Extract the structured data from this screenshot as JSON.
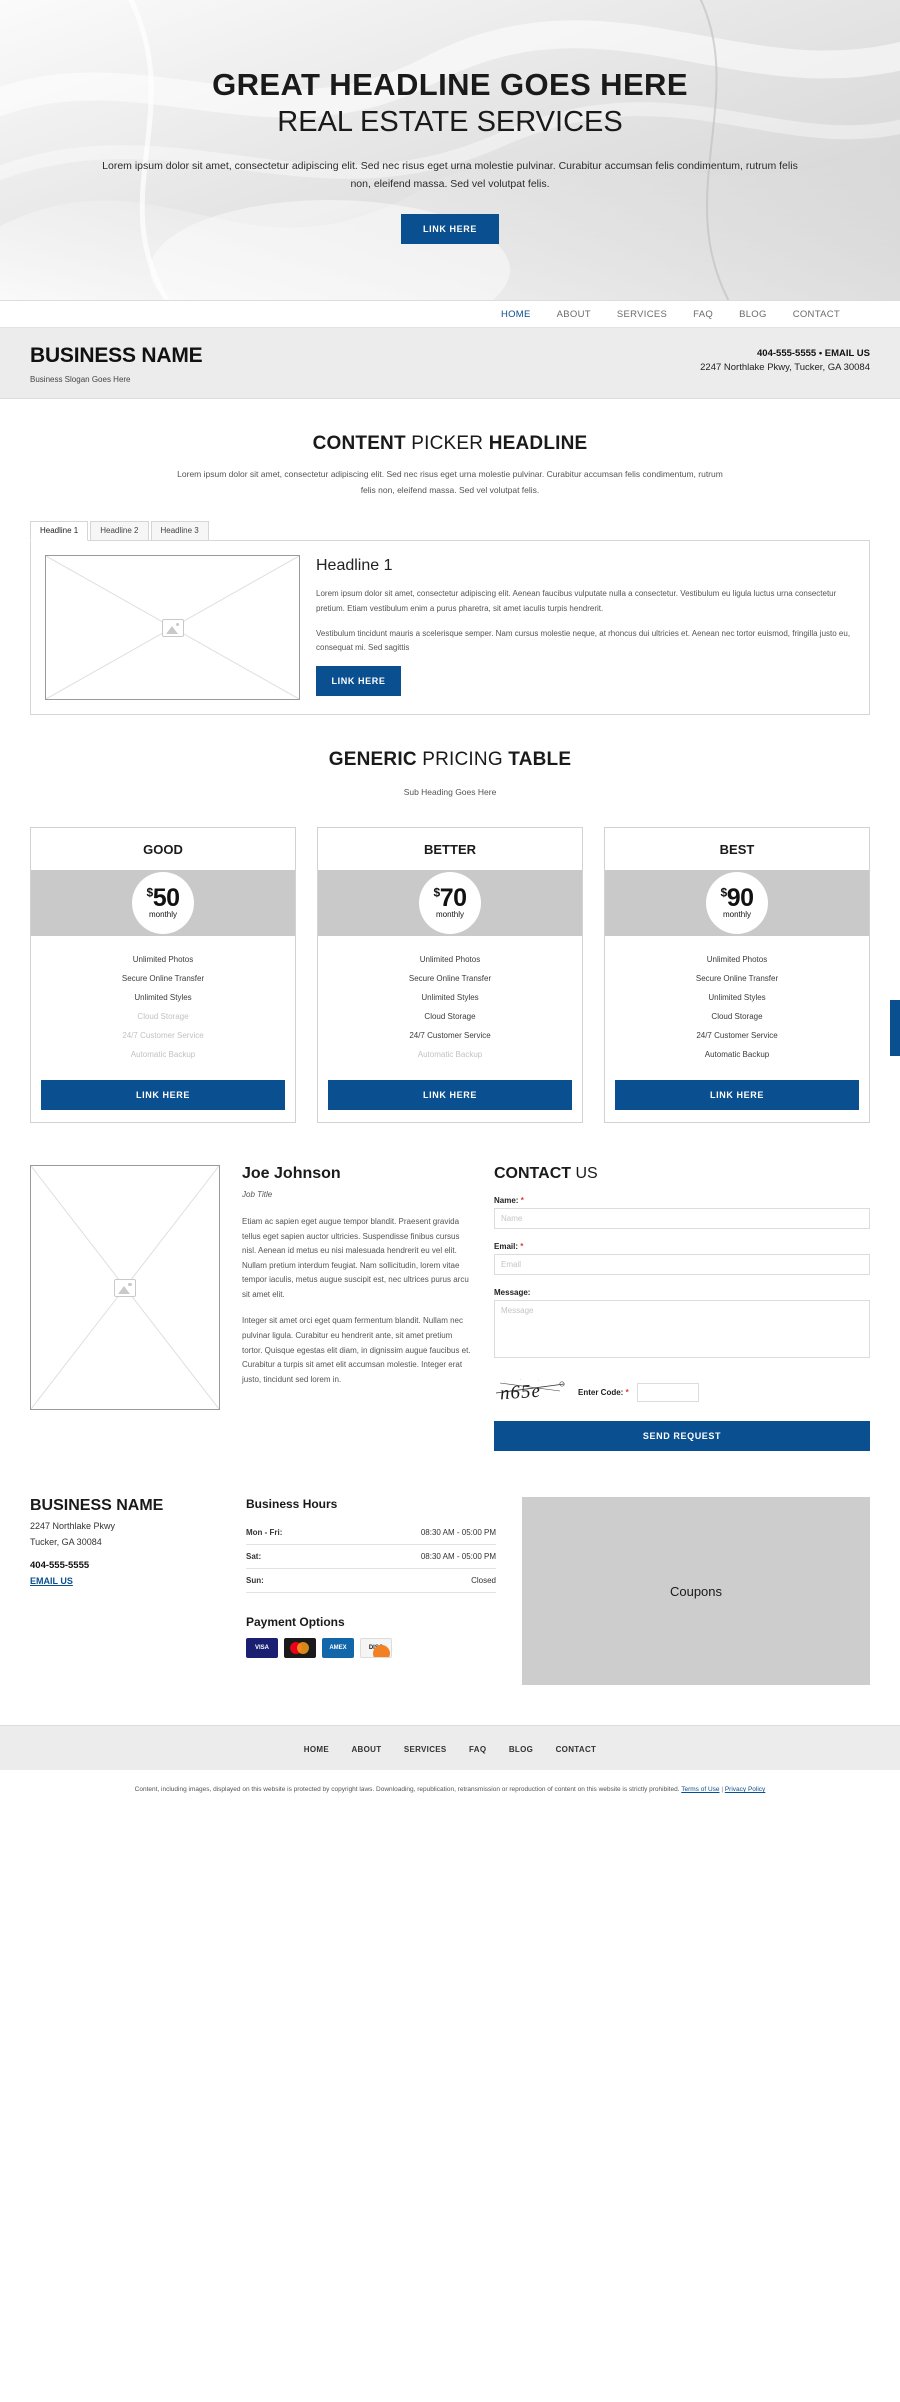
{
  "hero": {
    "headline": "GREAT HEADLINE GOES HERE",
    "subheadline": "REAL ESTATE SERVICES",
    "paragraph": "Lorem ipsum dolor sit amet, consectetur adipiscing elit. Sed nec risus eget urna molestie pulvinar. Curabitur accumsan felis condimentum, rutrum felis non, eleifend massa. Sed vel volutpat felis.",
    "button_label": "LINK HERE"
  },
  "nav": {
    "items": [
      {
        "label": "HOME",
        "active": true
      },
      {
        "label": "ABOUT",
        "active": false
      },
      {
        "label": "SERVICES",
        "active": false
      },
      {
        "label": "FAQ",
        "active": false
      },
      {
        "label": "BLOG",
        "active": false
      },
      {
        "label": "CONTACT",
        "active": false
      }
    ]
  },
  "business_header": {
    "name": "BUSINESS NAME",
    "slogan": "Business Slogan Goes Here",
    "phone_email": "404-555-5555 • EMAIL US",
    "address": "2247 Northlake Pkwy, Tucker, GA 30084"
  },
  "content_picker": {
    "title_part1": "CONTENT",
    "title_part2": "PICKER",
    "title_part3": "HEADLINE",
    "subtitle": "Lorem ipsum dolor sit amet, consectetur adipiscing elit. Sed nec risus eget urna molestie pulvinar. Curabitur accumsan felis condimentum, rutrum felis non, eleifend massa. Sed vel volutpat felis.",
    "tabs": [
      {
        "label": "Headline 1",
        "active": true
      },
      {
        "label": "Headline 2",
        "active": false
      },
      {
        "label": "Headline 3",
        "active": false
      }
    ],
    "panel": {
      "heading": "Headline 1",
      "paragraph1": "Lorem ipsum dolor sit amet, consectetur adipiscing elit. Aenean faucibus vulputate nulla a consectetur. Vestibulum eu ligula luctus urna consectetur pretium. Etiam vestibulum enim a purus pharetra, sit amet iaculis turpis hendrerit.",
      "paragraph2": "Vestibulum tincidunt mauris a scelerisque semper. Nam cursus molestie neque, at rhoncus dui ultricies et. Aenean nec tortor euismod, fringilla justo eu, consequat mi. Sed sagittis",
      "button_label": "LINK HERE"
    }
  },
  "pricing": {
    "title_part1": "GENERIC",
    "title_part2": "PRICING",
    "title_part3": "TABLE",
    "subheading": "Sub Heading Goes Here",
    "plans": [
      {
        "name": "GOOD",
        "currency": "$",
        "amount": "50",
        "period": "monthly",
        "button_label": "LINK HERE",
        "features": [
          {
            "label": "Unlimited Photos",
            "enabled": true
          },
          {
            "label": "Secure Online Transfer",
            "enabled": true
          },
          {
            "label": "Unlimited Styles",
            "enabled": true
          },
          {
            "label": "Cloud Storage",
            "enabled": false
          },
          {
            "label": "24/7 Customer Service",
            "enabled": false
          },
          {
            "label": "Automatic Backup",
            "enabled": false
          }
        ]
      },
      {
        "name": "BETTER",
        "currency": "$",
        "amount": "70",
        "period": "monthly",
        "button_label": "LINK HERE",
        "features": [
          {
            "label": "Unlimited Photos",
            "enabled": true
          },
          {
            "label": "Secure Online Transfer",
            "enabled": true
          },
          {
            "label": "Unlimited Styles",
            "enabled": true
          },
          {
            "label": "Cloud Storage",
            "enabled": true
          },
          {
            "label": "24/7 Customer Service",
            "enabled": true
          },
          {
            "label": "Automatic Backup",
            "enabled": false
          }
        ]
      },
      {
        "name": "BEST",
        "currency": "$",
        "amount": "90",
        "period": "monthly",
        "button_label": "LINK HERE",
        "features": [
          {
            "label": "Unlimited Photos",
            "enabled": true
          },
          {
            "label": "Secure Online Transfer",
            "enabled": true
          },
          {
            "label": "Unlimited Styles",
            "enabled": true
          },
          {
            "label": "Cloud Storage",
            "enabled": true
          },
          {
            "label": "24/7 Customer Service",
            "enabled": true
          },
          {
            "label": "Automatic Backup",
            "enabled": true
          }
        ]
      }
    ]
  },
  "bio": {
    "name": "Joe Johnson",
    "job_title": "Job Title",
    "paragraph1": "Etiam ac sapien eget augue tempor blandit. Praesent gravida tellus eget sapien auctor ultricies. Suspendisse finibus cursus nisl. Aenean id metus eu nisi malesuada hendrerit eu vel elit. Nullam pretium interdum feugiat. Nam sollicitudin, lorem vitae tempor iaculis, metus augue suscipit est, nec ultrices purus arcu sit amet elit.",
    "paragraph2": "Integer sit amet orci eget quam fermentum blandit. Nullam nec pulvinar ligula. Curabitur eu hendrerit ante, sit amet pretium tortor. Quisque egestas elit diam, in dignissim augue faucibus et. Curabitur a turpis sit amet elit accumsan molestie. Integer erat justo, tincidunt sed lorem in."
  },
  "contact": {
    "title_part1": "CONTACT",
    "title_part2": "US",
    "name_label": "Name:",
    "name_placeholder": "Name",
    "name_value": "",
    "email_label": "Email:",
    "email_placeholder": "Email",
    "email_value": "",
    "message_label": "Message:",
    "message_placeholder": "Message",
    "message_value": "",
    "captcha_code": "n65e",
    "enter_code_label": "Enter Code:",
    "code_value": "",
    "required_marker": "*",
    "submit_label": "SEND REQUEST"
  },
  "footer": {
    "business_name": "BUSINESS NAME",
    "address_line1": "2247 Northlake Pkwy",
    "address_line2": "Tucker, GA 30084",
    "phone": "404-555-5555",
    "email_label": "EMAIL US",
    "hours_title": "Business Hours",
    "hours": [
      {
        "day": "Mon - Fri:",
        "time": "08:30 AM - 05:00 PM"
      },
      {
        "day": "Sat:",
        "time": "08:30 AM - 05:00 PM"
      },
      {
        "day": "Sun:",
        "time": "Closed"
      }
    ],
    "payment_title": "Payment Options",
    "payment_cards": [
      "VISA",
      "MasterCard",
      "AMEX",
      "DISCOVER"
    ],
    "coupons_label": "Coupons",
    "nav_items": [
      "HOME",
      "ABOUT",
      "SERVICES",
      "FAQ",
      "BLOG",
      "CONTACT"
    ],
    "legal_text": "Content, including images, displayed on this website is protected by copyright laws. Downloading, republication, retransmission or reproduction of content on this website is strictly prohibited.",
    "legal_link1": "Terms of Use",
    "legal_sep": "|",
    "legal_link2": "Privacy Policy"
  },
  "colors": {
    "accent_blue": "#0a4f8f",
    "band_grey": "#c9c9c9",
    "required_red": "#e03b2f"
  }
}
